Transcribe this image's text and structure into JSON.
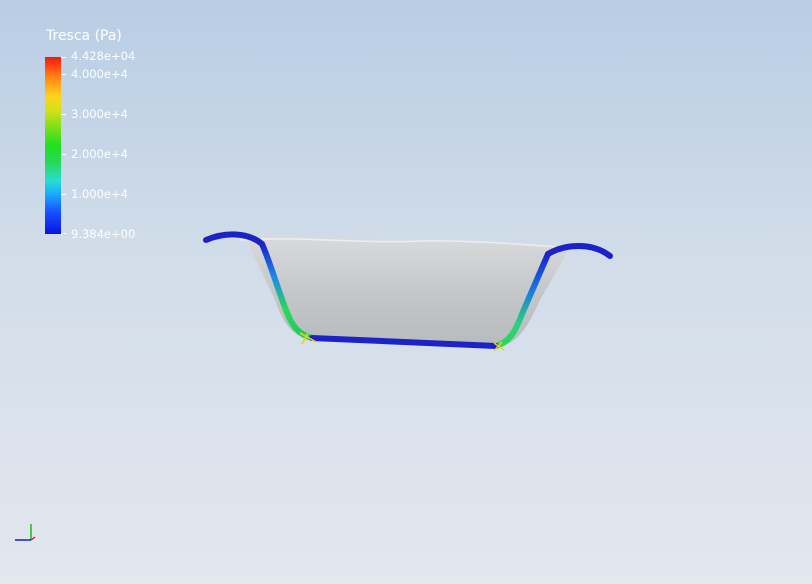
{
  "legend": {
    "title": "Tresca (Pa)",
    "max_label": "4.428e+04",
    "min_label": "9.384e+00",
    "ticks": [
      "4.000e+4",
      "3.000e+4",
      "2.000e+4",
      "1.000e+4"
    ],
    "colormap": "rainbow"
  },
  "scene": {
    "object": "stress-colored shell bowl",
    "background_top": "#b8cde4",
    "background_bottom": "#e3e7ee",
    "shell_color": "#c9cbcc",
    "low_stress_color": "#1a22c8",
    "high_stress_color": "#2ad85a"
  },
  "orientation_icon": "axes-triad-icon"
}
